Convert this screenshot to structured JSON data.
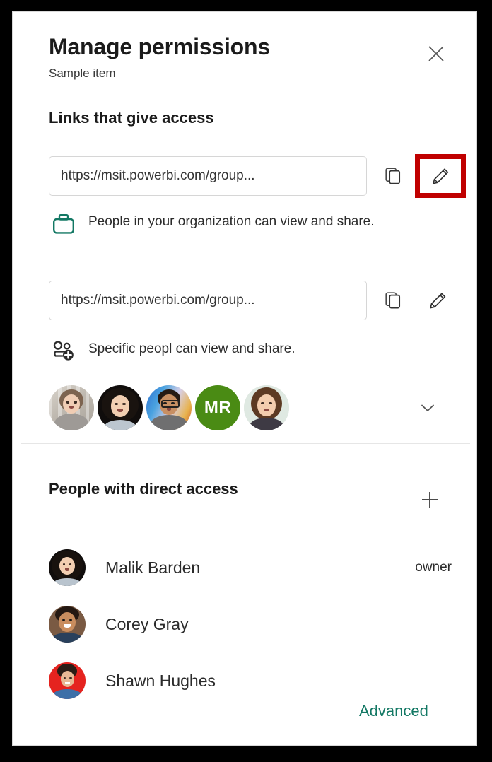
{
  "dialog": {
    "title": "Manage permissions",
    "subtitle": "Sample item",
    "close_label": "Close"
  },
  "links_section": {
    "heading": "Links that give access",
    "links": [
      {
        "url": "https://msit.powerbi.com/group...",
        "description": "People in your organization can view and share.",
        "scope_icon": "briefcase-icon",
        "scope_icon_color": "#137864",
        "copy_label": "Copy link",
        "edit_label": "Edit link",
        "highlighted": true
      },
      {
        "url": "https://msit.powerbi.com/group...",
        "description": "Specific peopl can view and share.",
        "scope_icon": "people-add-icon",
        "scope_icon_color": "#2b2b2b",
        "copy_label": "Copy link",
        "edit_label": "Edit link",
        "highlighted": false
      }
    ],
    "avatars": [
      {
        "type": "photo",
        "name": "person-1"
      },
      {
        "type": "photo",
        "name": "person-2"
      },
      {
        "type": "photo",
        "name": "person-3"
      },
      {
        "type": "initials",
        "name": "person-4",
        "initials": "MR",
        "color": "#4a8b14"
      },
      {
        "type": "photo",
        "name": "person-5"
      }
    ],
    "expand_label": "Show more"
  },
  "people_section": {
    "heading": "People with direct access",
    "add_label": "Add people",
    "people": [
      {
        "name": "Malik Barden",
        "role": "owner"
      },
      {
        "name": "Corey Gray",
        "role": ""
      },
      {
        "name": "Shawn Hughes",
        "role": ""
      }
    ]
  },
  "footer": {
    "advanced_label": "Advanced",
    "advanced_color": "#137864"
  },
  "highlight": {
    "color": "#c00000"
  }
}
